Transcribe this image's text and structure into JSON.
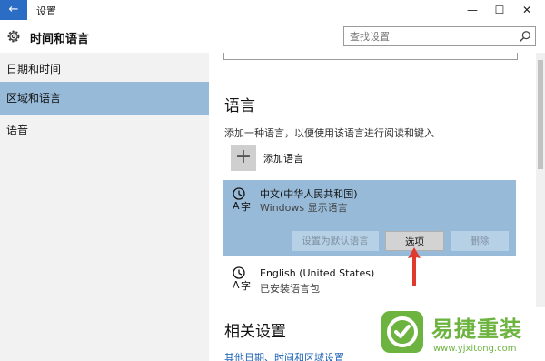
{
  "window": {
    "title": "设置",
    "back": "←",
    "minimize": "—",
    "maximize": "☐",
    "close": "✕"
  },
  "header": {
    "title": "时间和语言",
    "search_placeholder": "查找设置"
  },
  "sidebar": {
    "items": [
      {
        "label": "日期和时间",
        "active": false
      },
      {
        "label": "区域和语言",
        "active": true
      },
      {
        "label": "语音",
        "active": false
      }
    ]
  },
  "main": {
    "language_heading": "语言",
    "language_desc": "添加一种语言，以便使用该语言进行阅读和键入",
    "add_language": "添加语言",
    "languages": [
      {
        "name": "中文(中华人民共和国)",
        "subtitle": "Windows 显示语言",
        "selected": true,
        "buttons": {
          "set_default": "设置为默认语言",
          "options": "选项",
          "remove": "删除"
        }
      },
      {
        "name": "English (United States)",
        "subtitle": "已安装语言包",
        "selected": false
      }
    ],
    "related_heading": "相关设置",
    "related_link": "其他日期、时间和区域设置"
  },
  "watermark": {
    "title": "易捷重装",
    "url": "www.yjxitong.com"
  },
  "colors": {
    "accent": "#2b6cc4",
    "selected": "#97bad8",
    "link": "#1a5fb4",
    "arrow": "#e03a2f",
    "brand": "#6cb33f"
  }
}
